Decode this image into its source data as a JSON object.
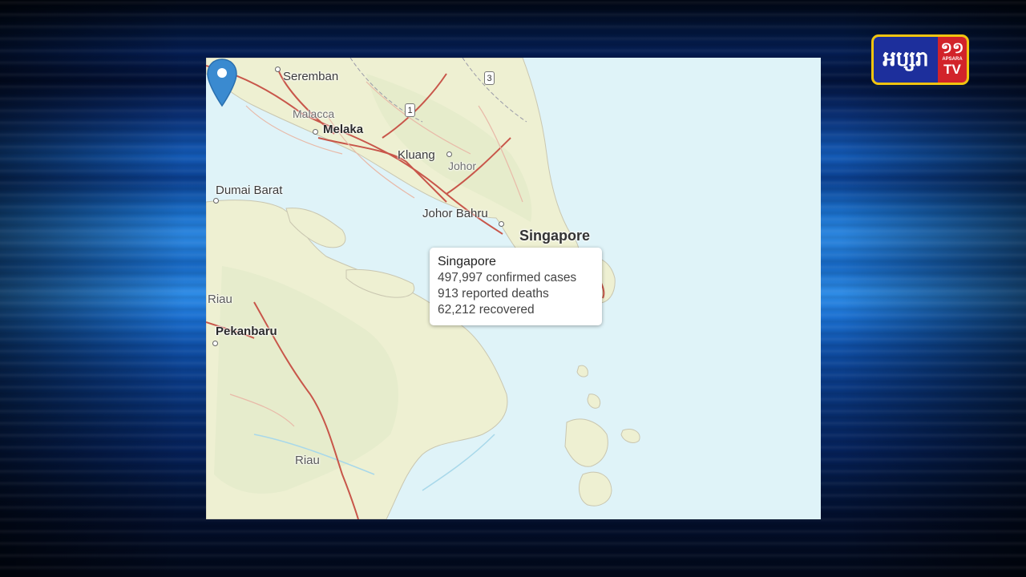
{
  "map": {
    "places": {
      "seremban": "Seremban",
      "malacca": "Malacca",
      "melaka": "Melaka",
      "kluang": "Kluang",
      "johor": "Johor",
      "johor_bahru": "Johor Bahru",
      "singapore": "Singapore",
      "dumai_barat": "Dumai Barat",
      "riau_west": "Riau",
      "pekanbaru": "Pekanbaru",
      "riau_south": "Riau"
    },
    "route_shields": [
      "3",
      "1"
    ]
  },
  "popup": {
    "title": "Singapore",
    "confirmed": "497,997 confirmed cases",
    "deaths": "913 reported deaths",
    "recovered": "62,212 recovered"
  },
  "logo": {
    "khmer_text": "អប្សរា",
    "number": "១១",
    "brand": "APSARA",
    "tv": "TV",
    "colors": {
      "blue": "#1d2f9c",
      "red": "#d2232a",
      "border": "#f1c40f"
    }
  },
  "colors": {
    "sea": "#dff3f8",
    "land": "#eef0d2",
    "road": "#c8564a",
    "marker": "#3a8ad0"
  }
}
